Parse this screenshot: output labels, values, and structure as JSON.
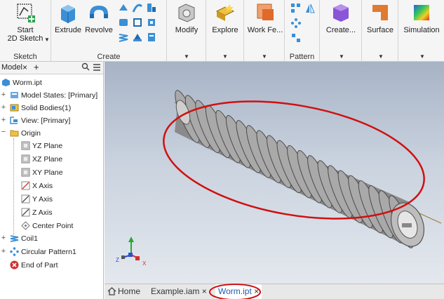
{
  "ribbon": {
    "sketch": {
      "start_label_1": "Start",
      "start_label_2": "2D Sketch",
      "group_label": "Sketch"
    },
    "create": {
      "extrude": "Extrude",
      "revolve": "Revolve",
      "group_label": "Create"
    },
    "modify": "Modify",
    "explore": "Explore",
    "work_features": "Work Fe...",
    "pattern": "Pattern",
    "create_freeform": "Create...",
    "surface": "Surface",
    "simulation": "Simulation"
  },
  "browser": {
    "tab_label": "Model",
    "close_glyph": "×",
    "add_glyph": "+",
    "items": [
      {
        "label": "Worm.ipt",
        "icon": "part-icon"
      },
      {
        "label": "Model States: [Primary]",
        "icon": "model-states-icon"
      },
      {
        "label": "Solid Bodies(1)",
        "icon": "solid-bodies-icon"
      },
      {
        "label": "View: [Primary]",
        "icon": "view-icon"
      },
      {
        "label": "Origin",
        "icon": "folder-icon"
      },
      {
        "label": "YZ Plane",
        "icon": "plane-icon"
      },
      {
        "label": "XZ Plane",
        "icon": "plane-icon"
      },
      {
        "label": "XY Plane",
        "icon": "plane-icon"
      },
      {
        "label": "X Axis",
        "icon": "axis-icon"
      },
      {
        "label": "Y Axis",
        "icon": "axis-icon"
      },
      {
        "label": "Z Axis",
        "icon": "axis-icon"
      },
      {
        "label": "Center Point",
        "icon": "point-icon"
      },
      {
        "label": "Coil1",
        "icon": "coil-icon"
      },
      {
        "label": "Circular Pattern1",
        "icon": "circular-pattern-icon"
      },
      {
        "label": "End of Part",
        "icon": "end-of-part-icon"
      }
    ]
  },
  "viewcube": {
    "z": "Z",
    "x": "X"
  },
  "doc_tabs": {
    "home": "Home",
    "assembly": "Example.iam",
    "part": "Worm.ipt",
    "close_glyph": "×"
  },
  "colors": {
    "highlight_ellipse": "#d01010",
    "thread_body": "#9a9a9a",
    "ribbon_bg": "#f5f5f5"
  }
}
